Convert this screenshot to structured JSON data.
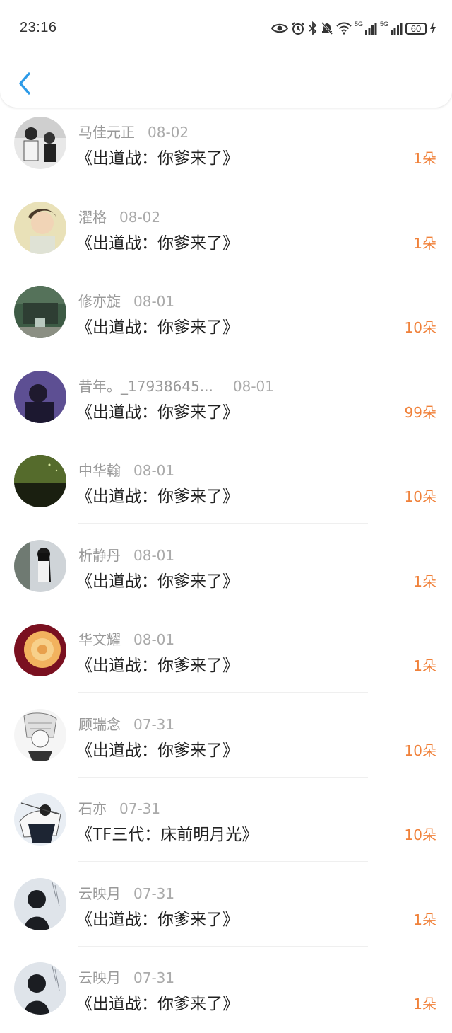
{
  "status_bar": {
    "time": "23:16",
    "net1": "5G",
    "net2": "5G",
    "battery": "60"
  },
  "nav": {
    "back_icon": "chevron-left-icon",
    "accent": "#2d9be8"
  },
  "colors": {
    "count": "#f0813a",
    "name": "#999999",
    "title": "#222222"
  },
  "records": [
    {
      "name": "马佳元正",
      "date": "08-02",
      "title": "《出道战：你爹来了》",
      "count": "1朵"
    },
    {
      "name": "濯格",
      "date": "08-02",
      "title": "《出道战：你爹来了》",
      "count": "1朵"
    },
    {
      "name": "修亦旋",
      "date": "08-01",
      "title": "《出道战：你爹来了》",
      "count": "10朵"
    },
    {
      "name": "昔年。_17938645...",
      "date": "08-01",
      "title": "《出道战：你爹来了》",
      "count": "99朵"
    },
    {
      "name": "中华翰",
      "date": "08-01",
      "title": "《出道战：你爹来了》",
      "count": "10朵"
    },
    {
      "name": "析静丹",
      "date": "08-01",
      "title": "《出道战：你爹来了》",
      "count": "1朵"
    },
    {
      "name": "华文耀",
      "date": "08-01",
      "title": "《出道战：你爹来了》",
      "count": "1朵"
    },
    {
      "name": "顾瑞念",
      "date": "07-31",
      "title": "《出道战：你爹来了》",
      "count": "10朵"
    },
    {
      "name": "石亦",
      "date": "07-31",
      "title": "《TF三代：床前明月光》",
      "count": "10朵"
    },
    {
      "name": "云映月",
      "date": "07-31",
      "title": "《出道战：你爹来了》",
      "count": "1朵"
    },
    {
      "name": "云映月",
      "date": "07-31",
      "title": "《出道战：你爹来了》",
      "count": "1朵"
    }
  ]
}
